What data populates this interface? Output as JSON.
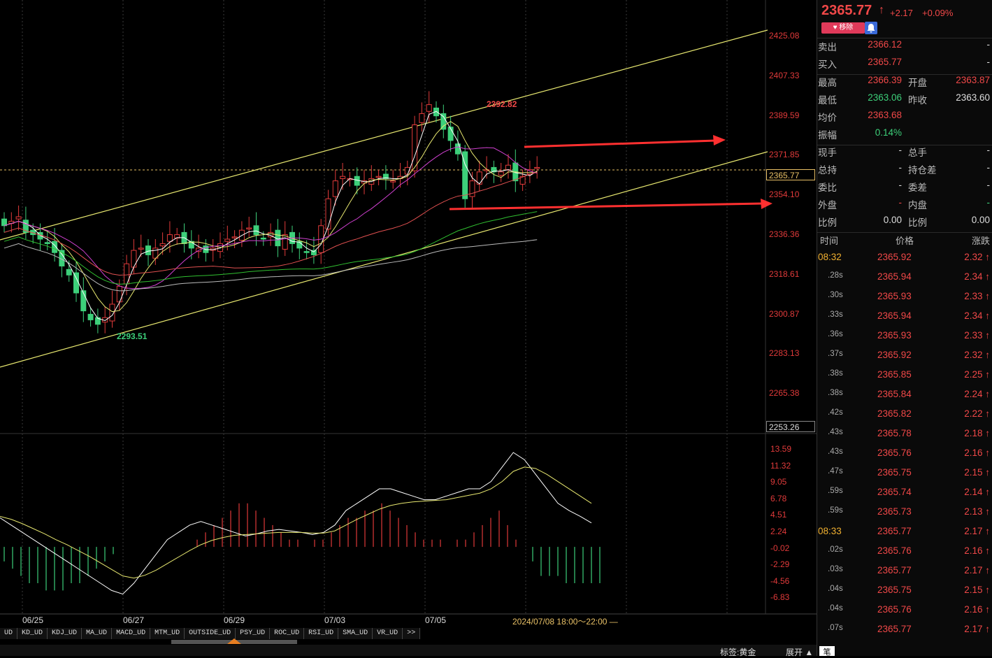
{
  "chart": {
    "price_axis": [
      "2425.08",
      "2407.33",
      "2389.59",
      "2371.85",
      "2354.10",
      "2336.36",
      "2318.61",
      "2300.87",
      "2283.13",
      "2265.38"
    ],
    "current_price_box": "2365.77",
    "bottom_price_box": "2253.26",
    "high_annotation": "2392.82",
    "low_annotation": "2293.51",
    "macd_axis": [
      "13.59",
      "11.32",
      "9.05",
      "6.78",
      "4.51",
      "2.24",
      "-0.02",
      "-2.29",
      "-4.56",
      "-6.83"
    ],
    "dates": [
      "06/25",
      "06/27",
      "06/29",
      "07/03",
      "07/05"
    ],
    "session": "2024/07/08 18:00～22:00 —",
    "colors": {
      "up": "#e03a3a",
      "down": "#3dd07a",
      "channel": "#e8e870",
      "arrow": "#ff3030"
    }
  },
  "tabs": [
    "UD",
    "KD_UD",
    "KDJ_UD",
    "MA_UD",
    "MACD_UD",
    "MTM_UD",
    "OUTSIDE_UD",
    "PSY_UD",
    "ROC_UD",
    "RSI_UD",
    "SMA_UD",
    "VR_UD",
    ">>"
  ],
  "footer": {
    "tag": "标签:黄金",
    "expand": "展开 ▲",
    "pen": "笔"
  },
  "quote": {
    "last": "2365.77",
    "arrow": "↑",
    "change": "+2.17",
    "change_pct": "+0.09%",
    "remove_label": "♥ 移除",
    "rows": [
      {
        "l1": "卖出",
        "v1": "2366.12",
        "c1": "red",
        "l2": "",
        "v2": "-",
        "c2": "white"
      },
      {
        "l1": "买入",
        "v1": "2365.77",
        "c1": "red",
        "l2": "",
        "v2": "-",
        "c2": "white"
      },
      {
        "l1": "最高",
        "v1": "2366.39",
        "c1": "red",
        "l2": "开盘",
        "v2": "2363.87",
        "c2": "red"
      },
      {
        "l1": "最低",
        "v1": "2363.06",
        "c1": "green",
        "l2": "昨收",
        "v2": "2363.60",
        "c2": "white"
      },
      {
        "l1": "均价",
        "v1": "2363.68",
        "c1": "red",
        "l2": "",
        "v2": "",
        "c2": "white"
      },
      {
        "l1": "振幅",
        "v1": "0.14%",
        "c1": "green",
        "l2": "",
        "v2": "",
        "c2": "white"
      },
      {
        "l1": "现手",
        "v1": "-",
        "c1": "white",
        "l2": "总手",
        "v2": "-",
        "c2": "white"
      },
      {
        "l1": "总持",
        "v1": "-",
        "c1": "white",
        "l2": "持仓差",
        "v2": "-",
        "c2": "white"
      },
      {
        "l1": "委比",
        "v1": "-",
        "c1": "white",
        "l2": "委差",
        "v2": "-",
        "c2": "white"
      },
      {
        "l1": "外盘",
        "v1": "-",
        "c1": "red",
        "l2": "内盘",
        "v2": "-",
        "c2": "green"
      },
      {
        "l1": "比例",
        "v1": "0.00",
        "c1": "white",
        "l2": "比例",
        "v2": "0.00",
        "c2": "white"
      }
    ],
    "tick_header": {
      "time": "时间",
      "price": "价格",
      "change": "涨跌"
    },
    "ticks": [
      {
        "t": "08:32",
        "major": true,
        "p": "2365.92",
        "c": "2.32 ↑"
      },
      {
        "t": ".28s",
        "major": false,
        "p": "2365.94",
        "c": "2.34 ↑"
      },
      {
        "t": ".30s",
        "major": false,
        "p": "2365.93",
        "c": "2.33 ↑"
      },
      {
        "t": ".33s",
        "major": false,
        "p": "2365.94",
        "c": "2.34 ↑"
      },
      {
        "t": ".36s",
        "major": false,
        "p": "2365.93",
        "c": "2.33 ↑"
      },
      {
        "t": ".37s",
        "major": false,
        "p": "2365.92",
        "c": "2.32 ↑"
      },
      {
        "t": ".38s",
        "major": false,
        "p": "2365.85",
        "c": "2.25 ↑"
      },
      {
        "t": ".38s",
        "major": false,
        "p": "2365.84",
        "c": "2.24 ↑"
      },
      {
        "t": ".42s",
        "major": false,
        "p": "2365.82",
        "c": "2.22 ↑"
      },
      {
        "t": ".43s",
        "major": false,
        "p": "2365.78",
        "c": "2.18 ↑"
      },
      {
        "t": ".43s",
        "major": false,
        "p": "2365.76",
        "c": "2.16 ↑"
      },
      {
        "t": ".47s",
        "major": false,
        "p": "2365.75",
        "c": "2.15 ↑"
      },
      {
        "t": ".59s",
        "major": false,
        "p": "2365.74",
        "c": "2.14 ↑"
      },
      {
        "t": ".59s",
        "major": false,
        "p": "2365.73",
        "c": "2.13 ↑"
      },
      {
        "t": "08:33",
        "major": true,
        "p": "2365.77",
        "c": "2.17 ↑"
      },
      {
        "t": ".02s",
        "major": false,
        "p": "2365.76",
        "c": "2.16 ↑"
      },
      {
        "t": ".03s",
        "major": false,
        "p": "2365.77",
        "c": "2.17 ↑"
      },
      {
        "t": ".04s",
        "major": false,
        "p": "2365.75",
        "c": "2.15 ↑"
      },
      {
        "t": ".04s",
        "major": false,
        "p": "2365.76",
        "c": "2.16 ↑"
      },
      {
        "t": ".07s",
        "major": false,
        "p": "2365.77",
        "c": "2.17 ↑"
      }
    ]
  }
}
